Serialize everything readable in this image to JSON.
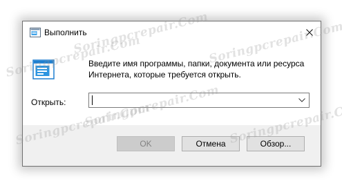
{
  "window": {
    "title": "Выполнить",
    "close_icon": "close-icon",
    "app_icon": "run-icon"
  },
  "content": {
    "description_line1": "Введите имя программы, папки, документа или ресурса",
    "description_line2": "Интернета, которые требуется открыть.",
    "open_label": "Открыть:",
    "open_value": "",
    "dropdown_icon": "chevron-down-icon"
  },
  "buttons": {
    "ok": "OK",
    "cancel": "Отмена",
    "browse": "Обзор..."
  },
  "watermark": {
    "text": "Soringpcrepair.Com"
  },
  "colors": {
    "footer_bg": "#f0f0f0",
    "button_bg": "#e1e1e1",
    "button_disabled_bg": "#cccccc",
    "icon_blue": "#1e7fd0"
  }
}
